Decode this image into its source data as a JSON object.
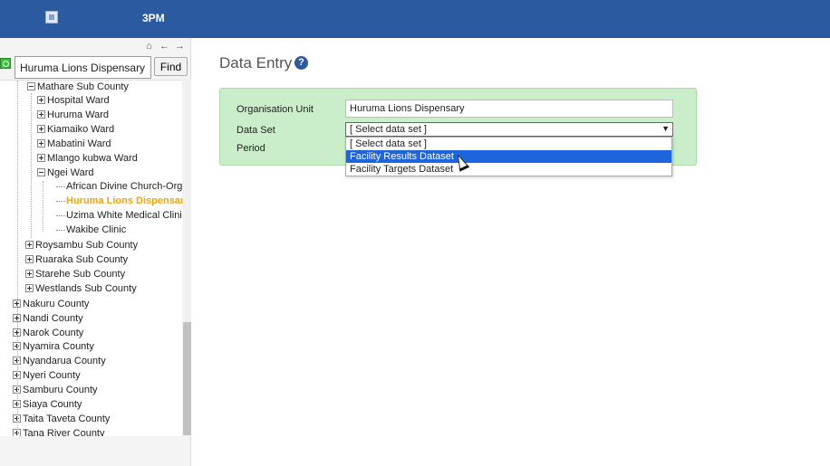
{
  "header": {
    "app_title": "3PM",
    "logo_icon": "broken-image-icon",
    "background": "#2c5aa0"
  },
  "tree_tools": [
    {
      "icon": "home-icon"
    },
    {
      "icon": "arrow-left-icon"
    },
    {
      "icon": "arrow-right-icon"
    }
  ],
  "search": {
    "value": "Huruma Lions Dispensary",
    "find_label": "Find"
  },
  "tree": {
    "items": [
      {
        "label": "Mathare Sub County",
        "toggle": "minus"
      },
      {
        "label": "Hospital Ward",
        "toggle": "plus"
      },
      {
        "label": "Huruma Ward",
        "toggle": "plus"
      },
      {
        "label": "Kiamaiko Ward",
        "toggle": "plus"
      },
      {
        "label": "Mabatini Ward",
        "toggle": "plus"
      },
      {
        "label": "Mlango kubwa Ward",
        "toggle": "plus"
      },
      {
        "label": "Ngei Ward",
        "toggle": "minus"
      },
      {
        "label": "African Divine Church-Org.",
        "toggle": "leaf"
      },
      {
        "label": "Huruma Lions Dispensary",
        "toggle": "leaf",
        "selected": true
      },
      {
        "label": "Uzima White Medical Clinic",
        "toggle": "leaf"
      },
      {
        "label": "Wakibe Clinic",
        "toggle": "leaf"
      },
      {
        "label": "Roysambu Sub County",
        "toggle": "plus"
      },
      {
        "label": "Ruaraka Sub County",
        "toggle": "plus"
      },
      {
        "label": "Starehe Sub County",
        "toggle": "plus"
      },
      {
        "label": "Westlands Sub County",
        "toggle": "plus"
      },
      {
        "label": "Nakuru County",
        "toggle": "plus"
      },
      {
        "label": "Nandi County",
        "toggle": "plus"
      },
      {
        "label": "Narok County",
        "toggle": "plus"
      },
      {
        "label": "Nyamira County",
        "toggle": "plus"
      },
      {
        "label": "Nyandarua County",
        "toggle": "plus"
      },
      {
        "label": "Nyeri County",
        "toggle": "plus"
      },
      {
        "label": "Samburu County",
        "toggle": "plus"
      },
      {
        "label": "Siaya County",
        "toggle": "plus"
      },
      {
        "label": "Taita Taveta County",
        "toggle": "plus"
      },
      {
        "label": "Tana River County",
        "toggle": "plus"
      }
    ],
    "selected_color": "#f0a30a"
  },
  "main": {
    "title": "Data Entry",
    "help_icon": "?",
    "form": {
      "org_unit_label": "Organisation Unit",
      "org_unit_value": "Huruma Lions Dispensary",
      "data_set_label": "Data Set",
      "data_set_value": "[ Select data set ]",
      "period_label": "Period"
    },
    "dropdown_options": [
      {
        "label": "[ Select data set ]"
      },
      {
        "label": "Facility Results Dataset",
        "highlighted": true
      },
      {
        "label": "Facility Targets Dataset"
      }
    ],
    "form_background": "#c9eec9",
    "highlight_color": "#1e64dc"
  }
}
